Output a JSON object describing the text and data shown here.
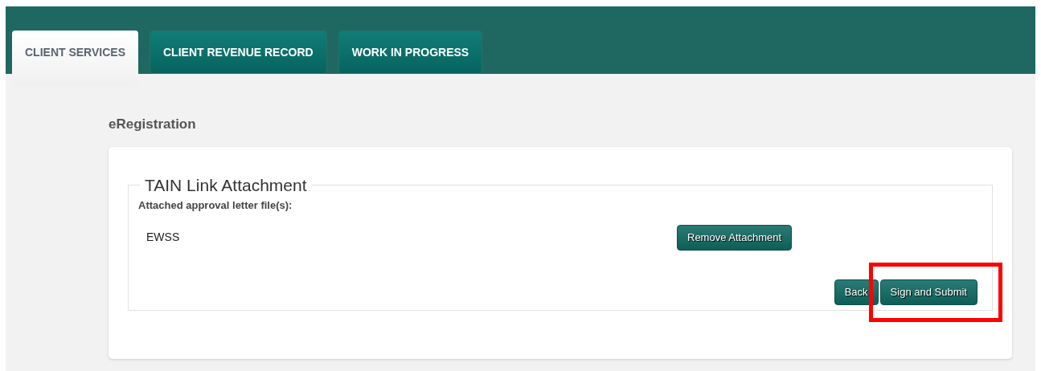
{
  "tabs": [
    {
      "label": "CLIENT SERVICES",
      "selected": true
    },
    {
      "label": "CLIENT REVENUE RECORD",
      "selected": false
    },
    {
      "label": "WORK IN PROGRESS",
      "selected": false
    }
  ],
  "page_title": "eRegistration",
  "fieldset": {
    "legend": "TAIN Link Attachment",
    "files_label": "Attached approval letter file(s):",
    "files": [
      {
        "name": "EWSS",
        "action": "Remove Attachment"
      }
    ]
  },
  "buttons": [
    {
      "label": "Back",
      "highlighted": false
    },
    {
      "label": "Sign and Submit",
      "highlighted": true
    }
  ]
}
